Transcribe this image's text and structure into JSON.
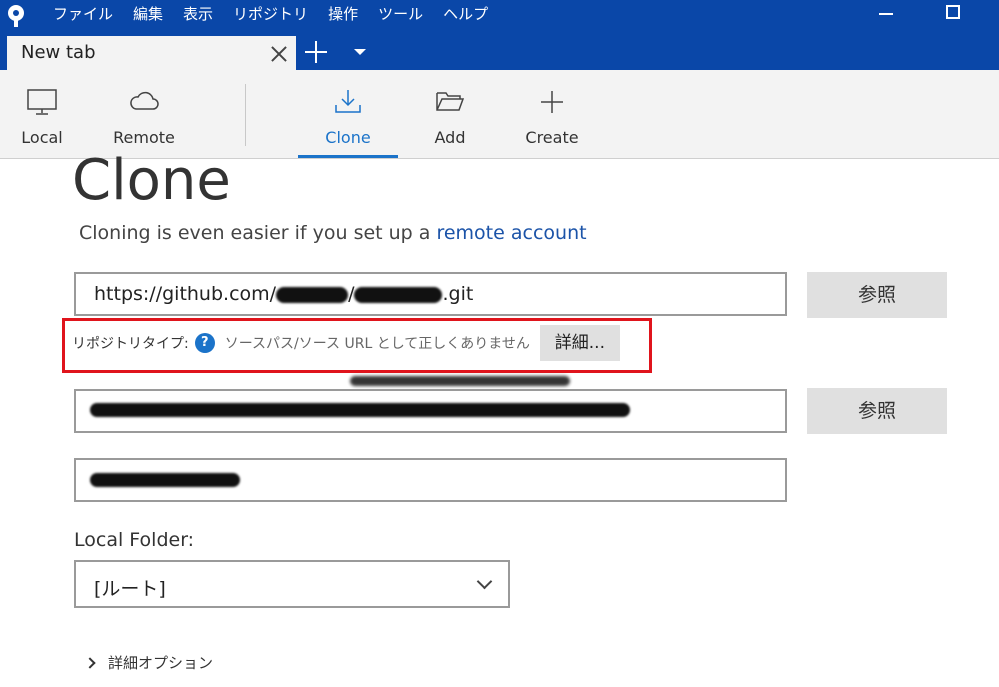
{
  "menu": [
    "ファイル",
    "編集",
    "表示",
    "リポジトリ",
    "操作",
    "ツール",
    "ヘルプ"
  ],
  "tab": {
    "title": "New tab"
  },
  "toolbar": {
    "local": "Local",
    "remote": "Remote",
    "clone": "Clone",
    "add": "Add",
    "create": "Create"
  },
  "page": {
    "title": "Clone",
    "subtitle_text": "Cloning is even easier if you set up a ",
    "subtitle_link": "remote account"
  },
  "source": {
    "prefix": "https://github.com/",
    "sep": "/",
    "suffix": ".git",
    "browse_label": "参照"
  },
  "error": {
    "label": "リポジトリタイプ:",
    "help_glyph": "?",
    "message": "ソースパス/ソース URL として正しくありません",
    "details_label": "詳細..."
  },
  "destination": {
    "browse_label": "参照"
  },
  "local_folder": {
    "label": "Local Folder:",
    "selected": "[ルート]"
  },
  "advanced": {
    "label": "詳細オプション"
  },
  "colors": {
    "titlebar": "#0a47a8",
    "accent": "#1b73c9",
    "error_border": "#e0141c"
  }
}
